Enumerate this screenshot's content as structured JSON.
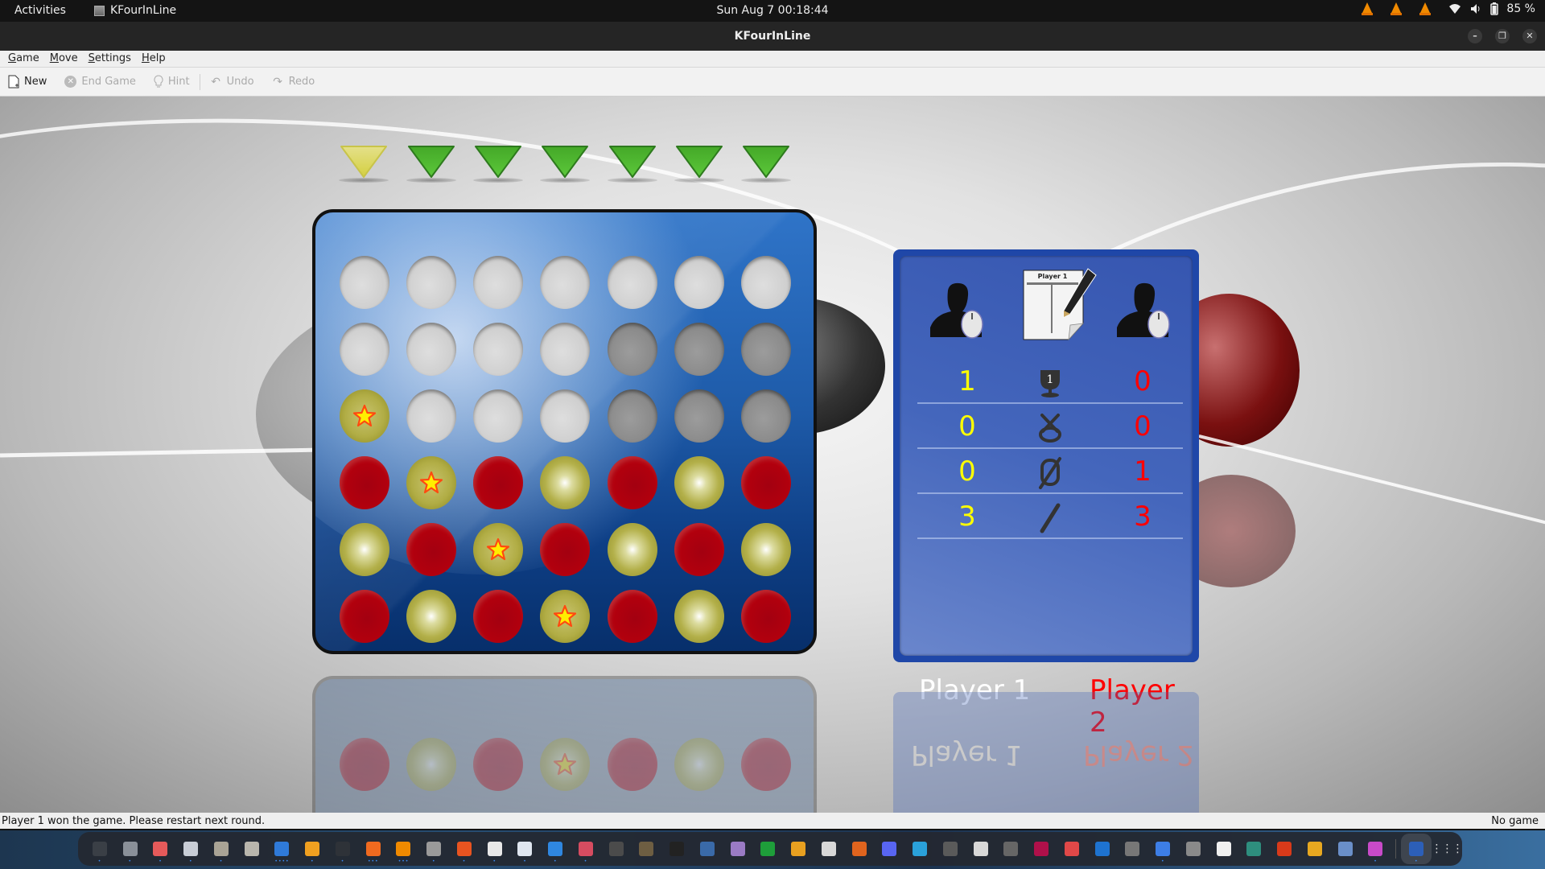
{
  "topbar": {
    "activities": "Activities",
    "app_name": "KFourInLine",
    "clock": "Sun Aug 7  00:18:44",
    "battery": "85 %"
  },
  "window": {
    "title": "KFourInLine"
  },
  "menu": [
    "Game",
    "Move",
    "Settings",
    "Help"
  ],
  "toolbar": {
    "new": "New",
    "end_game": "End Game",
    "hint": "Hint",
    "undo": "Undo",
    "redo": "Redo"
  },
  "game": {
    "column_arrows": [
      {
        "color": "yellow",
        "state": "active"
      },
      {
        "color": "green"
      },
      {
        "color": "green"
      },
      {
        "color": "green"
      },
      {
        "color": "green"
      },
      {
        "color": "green"
      },
      {
        "color": "green"
      }
    ],
    "board": [
      [
        "empty",
        "empty",
        "empty",
        "empty",
        "empty",
        "empty",
        "empty"
      ],
      [
        "empty",
        "empty",
        "empty",
        "empty",
        "empty",
        "empty",
        "empty"
      ],
      [
        "yellow",
        "empty",
        "empty",
        "empty",
        "empty",
        "empty",
        "empty"
      ],
      [
        "red",
        "yellow",
        "red",
        "yellow",
        "red",
        "yellow",
        "red"
      ],
      [
        "yellow",
        "red",
        "yellow",
        "red",
        "yellow",
        "red",
        "yellow"
      ],
      [
        "red",
        "yellow",
        "red",
        "yellow",
        "red",
        "yellow",
        "red"
      ]
    ],
    "winning_cells": [
      [
        2,
        0
      ],
      [
        3,
        1
      ],
      [
        4,
        2
      ],
      [
        5,
        3
      ]
    ],
    "colors": {
      "red": "#b2000e",
      "yellow": "#b3b04a",
      "board": "#1e5ba9",
      "arrow_green": "#5cc83a",
      "arrow_yellow": "#d4d040"
    }
  },
  "scoreboard": {
    "move_sheet_label": "Player 1",
    "rows": [
      {
        "icon": "trophy-icon",
        "p1": "1",
        "p2": "0",
        "meaning": "wins"
      },
      {
        "icon": "remis-icon",
        "p1": "0",
        "p2": "0",
        "meaning": "draws"
      },
      {
        "icon": "loss-icon",
        "p1": "0",
        "p2": "1",
        "meaning": "losses"
      },
      {
        "icon": "brk-icon",
        "p1": "3",
        "p2": "3",
        "meaning": "aborted"
      }
    ],
    "player1_name": "Player 1",
    "player2_name": "Player 2",
    "player1_color": "#ffffff",
    "player2_color": "#ff0000",
    "p1_score_color": "#ffff00",
    "p2_score_color": "#ff0000"
  },
  "statusbar": {
    "message": "Player 1 won the game. Please restart next round.",
    "state": "No game"
  },
  "dock": {
    "apps": [
      {
        "name": "system-monitor",
        "color": "#3a3f46",
        "dots": "•"
      },
      {
        "name": "files",
        "color": "#8a9099",
        "dots": "•"
      },
      {
        "name": "disk-usage",
        "color": "#e65a5a",
        "dots": "•"
      },
      {
        "name": "scanner",
        "color": "#c8cdd6",
        "dots": "•"
      },
      {
        "name": "archive-manager",
        "color": "#a9a395",
        "dots": "•"
      },
      {
        "name": "image-viewer",
        "color": "#b9b6ad",
        "dots": ""
      },
      {
        "name": "text-document",
        "color": "#2f7ad8",
        "dots": "••••"
      },
      {
        "name": "calculator",
        "color": "#f0a020",
        "dots": "•"
      },
      {
        "name": "terminal",
        "color": "#2e3238",
        "dots": "•"
      },
      {
        "name": "firefox",
        "color": "#f06a1f",
        "dots": "•••"
      },
      {
        "name": "vlc",
        "color": "#f08a00",
        "dots": "•••"
      },
      {
        "name": "disks",
        "color": "#9a9a9a",
        "dots": "•"
      },
      {
        "name": "software",
        "color": "#e95420",
        "dots": "•"
      },
      {
        "name": "text-editor",
        "color": "#e8e8e8",
        "dots": "•"
      },
      {
        "name": "settings-toggle",
        "color": "#dfe6f0",
        "dots": "•"
      },
      {
        "name": "help",
        "color": "#2f87e0",
        "dots": "•"
      },
      {
        "name": "waveform",
        "color": "#d64c60",
        "dots": "•"
      },
      {
        "name": "speaker",
        "color": "#4b4b4b",
        "dots": ""
      },
      {
        "name": "gimp",
        "color": "#6e5e42",
        "dots": ""
      },
      {
        "name": "inkscape",
        "color": "#222222",
        "dots": ""
      },
      {
        "name": "virtualbox",
        "color": "#3a6aa8",
        "dots": ""
      },
      {
        "name": "screenshot",
        "color": "#9a7bc4",
        "dots": ""
      },
      {
        "name": "spreadsheet",
        "color": "#1e9e3a",
        "dots": ""
      },
      {
        "name": "drawing",
        "color": "#e8a020",
        "dots": ""
      },
      {
        "name": "formula",
        "color": "#d8d8d8",
        "dots": ""
      },
      {
        "name": "presentation",
        "color": "#e0641e",
        "dots": ""
      },
      {
        "name": "discord",
        "color": "#5865f2",
        "dots": ""
      },
      {
        "name": "telegram",
        "color": "#2aa1da",
        "dots": ""
      },
      {
        "name": "clock",
        "color": "#5a5a5a",
        "dots": ""
      },
      {
        "name": "dictionary",
        "color": "#d8d8d8",
        "dots": ""
      },
      {
        "name": "seventy-six",
        "color": "#666666",
        "dots": ""
      },
      {
        "name": "chip",
        "color": "#b0104a",
        "dots": ""
      },
      {
        "name": "downloader",
        "color": "#e04848",
        "dots": ""
      },
      {
        "name": "window-app",
        "color": "#1e73d0",
        "dots": ""
      },
      {
        "name": "accessories",
        "color": "#777777",
        "dots": ""
      },
      {
        "name": "calc-game",
        "color": "#3d7ee6",
        "dots": "•"
      },
      {
        "name": "ring",
        "color": "#8a8a8a",
        "dots": ""
      },
      {
        "name": "solitaire",
        "color": "#f0f0f0",
        "dots": ""
      },
      {
        "name": "sokoban",
        "color": "#2e8e7e",
        "dots": ""
      },
      {
        "name": "mario",
        "color": "#d83a1a",
        "dots": ""
      },
      {
        "name": "ball",
        "color": "#e8a820",
        "dots": ""
      },
      {
        "name": "diamond",
        "color": "#6a8fc8",
        "dots": ""
      },
      {
        "name": "tetris",
        "color": "#c84ac8",
        "dots": "•"
      }
    ],
    "active_app": {
      "name": "kfourinline",
      "color": "#2c5fb8",
      "dots": "•"
    },
    "show_apps": "show-applications"
  }
}
